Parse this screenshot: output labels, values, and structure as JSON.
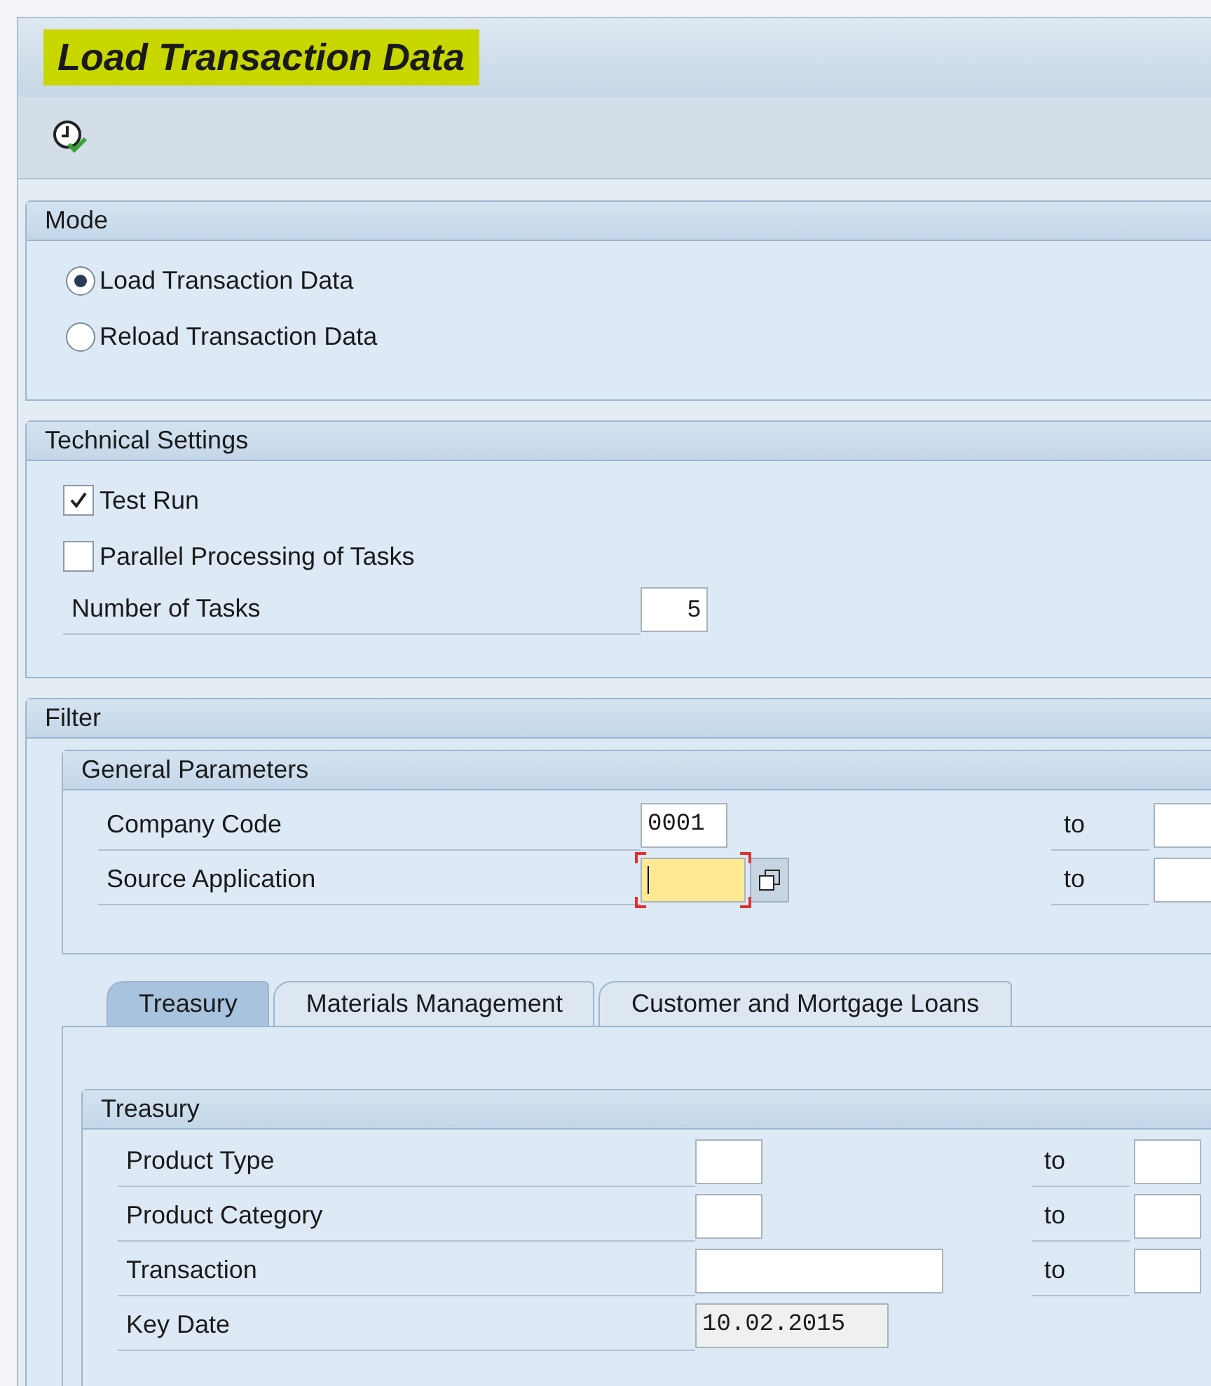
{
  "window": {
    "title": "Load Transaction Data"
  },
  "mode": {
    "title": "Mode",
    "options": [
      {
        "label": "Load Transaction Data",
        "selected": true
      },
      {
        "label": "Reload Transaction Data",
        "selected": false
      }
    ]
  },
  "technical_settings": {
    "title": "Technical Settings",
    "checkboxes": [
      {
        "label": "Test Run",
        "checked": true
      },
      {
        "label": "Parallel Processing of Tasks",
        "checked": false
      }
    ],
    "number_of_tasks": {
      "label": "Number of Tasks",
      "value": "5"
    }
  },
  "filter": {
    "title": "Filter",
    "general_parameters": {
      "title": "General Parameters",
      "rows": [
        {
          "label": "Company Code",
          "value": "0001",
          "focused": false,
          "to_label": "to"
        },
        {
          "label": "Source Application",
          "value": "",
          "focused": true,
          "to_label": "to"
        }
      ]
    },
    "tabs": [
      {
        "label": "Treasury",
        "selected": true
      },
      {
        "label": "Materials Management",
        "selected": false
      },
      {
        "label": "Customer and Mortgage Loans",
        "selected": false
      }
    ],
    "treasury": {
      "title": "Treasury",
      "rows": [
        {
          "label": "Product Type",
          "value": "",
          "readonly": false,
          "to_label": "to"
        },
        {
          "label": "Product Category",
          "value": "",
          "readonly": false,
          "to_label": "to"
        },
        {
          "label": "Transaction",
          "value": "",
          "readonly": false,
          "to_label": "to"
        },
        {
          "label": "Key Date",
          "value": "10.02.2015",
          "readonly": true
        }
      ]
    }
  }
}
